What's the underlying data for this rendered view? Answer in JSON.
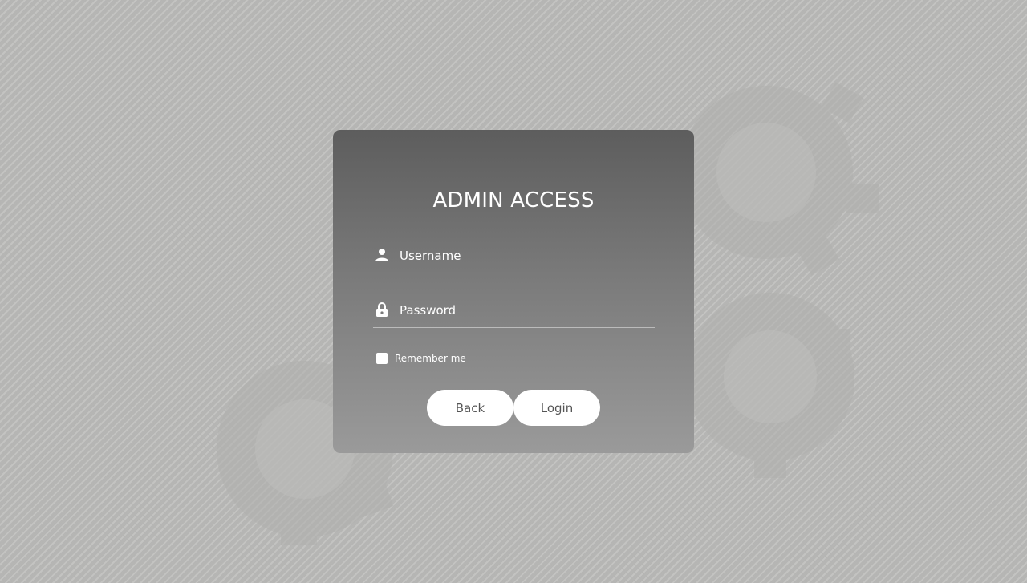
{
  "title": "ADMIN ACCESS",
  "fields": {
    "username": {
      "placeholder": "Username",
      "value": "",
      "icon": "user-icon"
    },
    "password": {
      "placeholder": "Password",
      "value": "",
      "icon": "lock-icon"
    }
  },
  "remember": {
    "label": "Remember me",
    "checked": false
  },
  "buttons": {
    "back": "Back",
    "login": "Login"
  },
  "colors": {
    "card_top": "#5d5d5d",
    "card_bottom": "#9a9a9a",
    "background": "#bcbcba",
    "button": "#ffffff",
    "button_text": "#555555"
  }
}
